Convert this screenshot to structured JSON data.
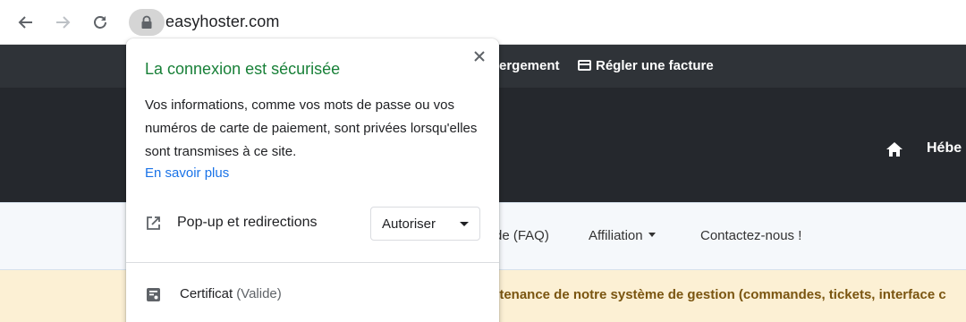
{
  "browser": {
    "url": "easyhoster.com",
    "icons": {
      "back": "arrow-left-icon",
      "forward": "arrow-right-icon",
      "reload": "reload-icon",
      "lock": "lock-icon"
    }
  },
  "page": {
    "top_nav": {
      "hosting_partial": "ergement",
      "pay_invoice": "Régler une facture"
    },
    "hero": {
      "home_label": "Hébe"
    },
    "sub_nav": {
      "faq_partial": "de (FAQ)",
      "affiliation": "Affiliation",
      "contact": "Contactez-nous !"
    },
    "notice": "intenance de notre système de gestion (commandes, tickets, interface c"
  },
  "popover": {
    "title": "La connexion est sécurisée",
    "description": "Vos informations, comme vos mots de passe ou vos numéros de carte de paiement, sont privées lorsqu'elles sont transmises à ce site.",
    "learn_more": "En savoir plus",
    "permission": {
      "label": "Pop-up et redirections",
      "value": "Autoriser"
    },
    "certificate": {
      "label": "Certificat",
      "status": "(Valide)"
    }
  },
  "colors": {
    "secure_green": "#188038",
    "link_blue": "#1a73e8",
    "header_dark": "#2f3338",
    "hero_dark": "#25282d",
    "notice_bg": "#fcf0d4",
    "notice_text": "#7a5510"
  }
}
